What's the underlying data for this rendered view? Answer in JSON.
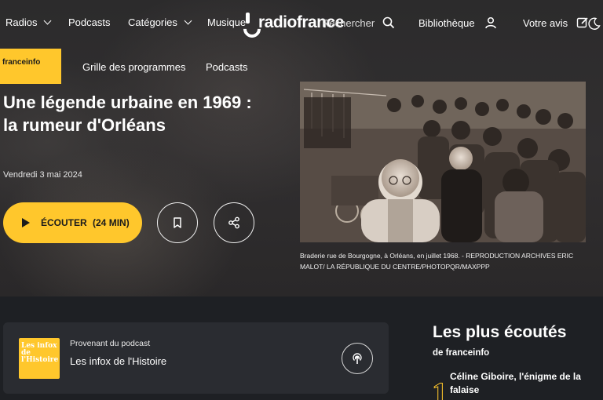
{
  "nav": {
    "radios": "Radios",
    "podcasts": "Podcasts",
    "categories": "Catégories",
    "musique": "Musique",
    "rechercher": "Rechercher",
    "bibliotheque": "Bibliothèque",
    "avis": "Votre avis",
    "logo": "radiofrance"
  },
  "subnav": {
    "brand": "franceinfo",
    "grille": "Grille des programmes",
    "podcasts": "Podcasts"
  },
  "article": {
    "title": "Une légende urbaine en 1969 : la rumeur d'Orléans",
    "date": "Vendredi 3 mai 2024",
    "listen_label": "ÉCOUTER",
    "duration": "(24 MIN)",
    "caption": "Braderie rue de Bourgogne, à Orléans, en juillet 1968. - REPRODUCTION ARCHIVES ERIC MALOT/ LA RÉPUBLIQUE DU CENTRE/PHOTOPQR/MAXPPP"
  },
  "podcast_card": {
    "from_label": "Provenant du podcast",
    "name": "Les infox de l'Histoire",
    "thumb_text": "Les infox de l'Histoire"
  },
  "most_listened": {
    "title": "Les plus écoutés",
    "subtitle": "de franceinfo",
    "items": [
      {
        "rank": "1",
        "title": "Céline Giboire, l'énigme de la falaise"
      }
    ]
  },
  "colors": {
    "accent": "#ffc72c",
    "background": "#1e2024",
    "card": "#2a2c31"
  },
  "icons": [
    "chevron-down-icon",
    "search-icon",
    "user-icon",
    "edit-icon",
    "dark-mode-icon",
    "play-icon",
    "bookmark-icon",
    "share-icon",
    "podcast-icon"
  ]
}
